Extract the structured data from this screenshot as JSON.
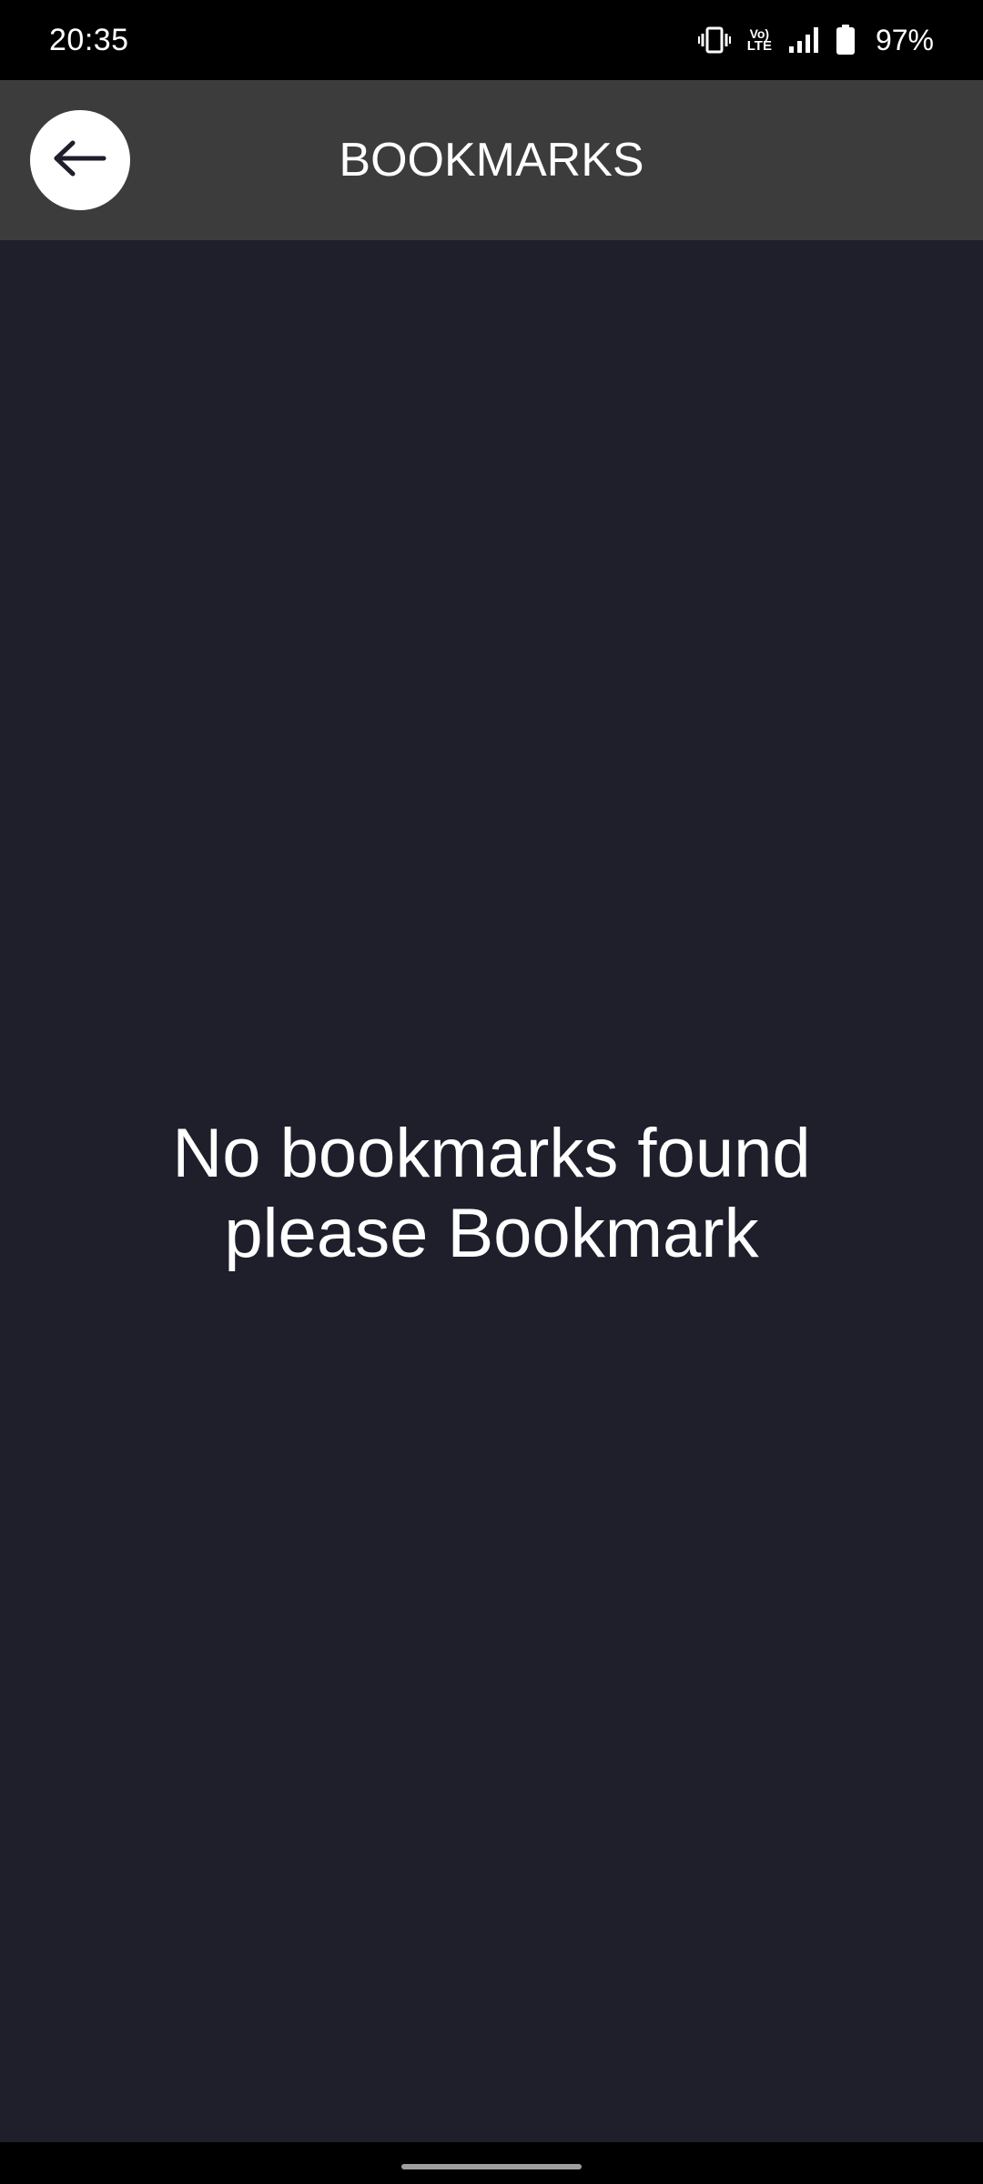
{
  "status_bar": {
    "time": "20:35",
    "network_label": "LTE",
    "volte_label": "Vo)",
    "battery_percent": "97%",
    "icons": [
      "vibrate-icon",
      "volte-icon",
      "signal-icon",
      "battery-icon"
    ]
  },
  "app_bar": {
    "title": "BOOKMARKS",
    "back_icon": "arrow-left-icon"
  },
  "empty_state": {
    "line1": "No bookmarks found",
    "line2": "please Bookmark"
  },
  "colors": {
    "background": "#1f1e2b",
    "app_bar": "#3c3c3c",
    "status_bar": "#000000",
    "text": "#ffffff"
  }
}
